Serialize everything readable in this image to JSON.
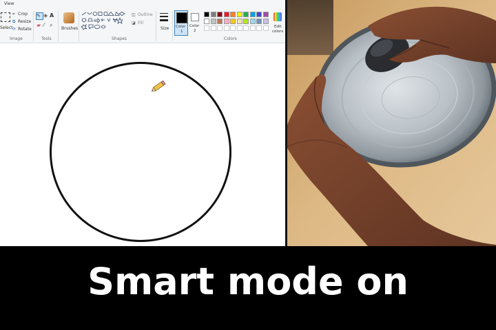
{
  "paint": {
    "tabs": {
      "view": "View"
    },
    "image": {
      "select": "Select",
      "crop": "Crop",
      "resize": "Resize",
      "rotate": "Rotate",
      "group": "Image"
    },
    "tools": {
      "group": "Tools"
    },
    "brushes": {
      "label": "Brushes"
    },
    "shapes": {
      "outline": "Outline",
      "fill": "Fill",
      "group": "Shapes"
    },
    "size": {
      "label": "Size"
    },
    "colors": {
      "color1_line1": "Color",
      "color1_line2": "1",
      "color2_line1": "Color",
      "color2_line2": "2",
      "edit_line1": "Edit",
      "edit_line2": "colors",
      "group": "Colors",
      "row1": [
        "#000000",
        "#7f7f7f",
        "#880015",
        "#ed1c24",
        "#ff7f27",
        "#fff200",
        "#22b14c",
        "#00a2e8",
        "#3f48cc",
        "#a349a4"
      ],
      "row2": [
        "#ffffff",
        "#c3c3c3",
        "#b97a57",
        "#ffaec9",
        "#ffc90e",
        "#efe4b0",
        "#b5e61d",
        "#99d9ea",
        "#7092be",
        "#c8bfe7"
      ],
      "color1": "#000000",
      "color2": "#ffffff"
    }
  },
  "caption": "Smart mode on"
}
